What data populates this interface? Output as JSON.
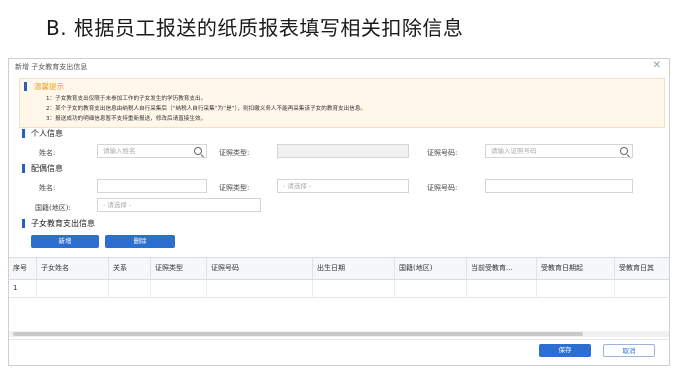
{
  "slide": {
    "title": "B. 根据员工报送的纸质报表填写相关扣除信息"
  },
  "dialog": {
    "title": "新增 子女教育支出信息",
    "close_icon": "✕",
    "notice": {
      "title": "温馨提示",
      "lines": [
        "1：子女教育支出仅限于未参加工作的子女发生的学历教育支出。",
        "2：某个子女的教育支出信息由纳税人自行采集后（“纳税人自行采集”为“是”），则扣缴义务人不能再采集该子女的教育支出信息。",
        "3：报送成功的明细信息暂不支持重新报送，修改后请直接生效。"
      ]
    },
    "personal": {
      "section_title": "个人信息",
      "name_label": "姓名:",
      "name_placeholder": "请输入姓名",
      "id_type_label": "证照类型:",
      "id_no_label": "证照号码:",
      "id_no_placeholder": "请输入证照号码"
    },
    "spouse": {
      "section_title": "配偶信息",
      "name_label": "姓名:",
      "id_type_label": "证照类型:",
      "id_type_select": "- 请选择 -",
      "id_no_label": "证照号码:",
      "nationality_label": "国籍(地区):",
      "nationality_select": "- 请选择 -"
    },
    "children": {
      "section_title": "子女教育支出信息",
      "add_button": "新增",
      "delete_button": "删除",
      "columns": [
        "序号",
        "子女姓名",
        "关系",
        "证照类型",
        "证照号码",
        "出生日期",
        "国籍(地区)",
        "当前受教育...",
        "受教育日期起",
        "受教育日其"
      ],
      "rows": [
        {
          "index": "1"
        }
      ]
    },
    "footer": {
      "save_button": "保存",
      "cancel_button": "取消"
    }
  }
}
